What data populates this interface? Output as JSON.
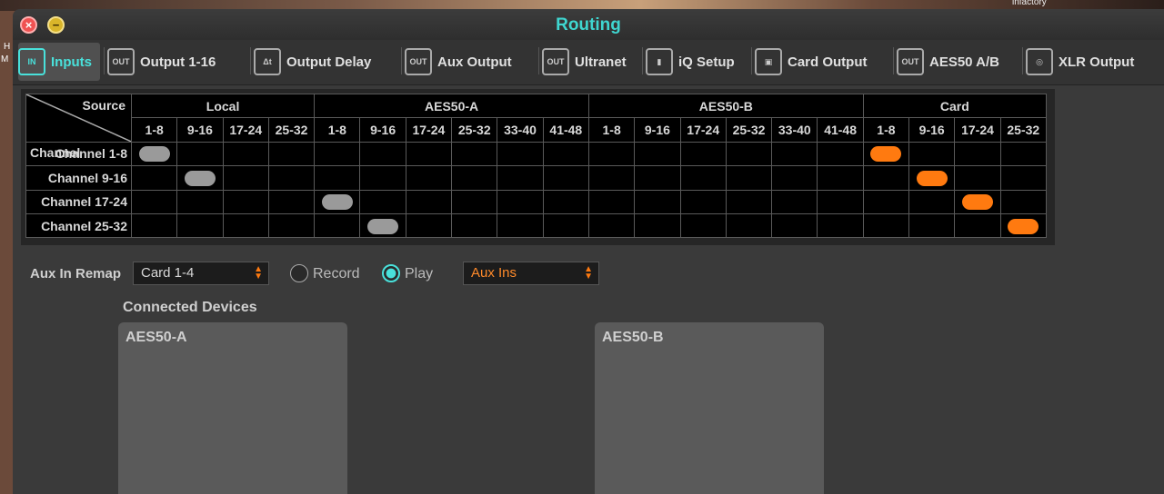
{
  "desktop": {
    "corner_text": "infactory",
    "side_h": "H",
    "side_m": "M"
  },
  "window": {
    "title": "Routing"
  },
  "tabs": [
    {
      "label": "Inputs",
      "icon": "input-icon",
      "glyph": "IN"
    },
    {
      "label": "Output 1-16",
      "icon": "output-icon",
      "glyph": "OUT"
    },
    {
      "label": "Output Delay",
      "icon": "delay-icon",
      "glyph": "Δt"
    },
    {
      "label": "Aux Output",
      "icon": "aux-output-icon",
      "glyph": "OUT"
    },
    {
      "label": "Ultranet",
      "icon": "ultranet-icon",
      "glyph": "OUT"
    },
    {
      "label": "iQ Setup",
      "icon": "speaker-icon",
      "glyph": "▮"
    },
    {
      "label": "Card Output",
      "icon": "card-icon",
      "glyph": "▣"
    },
    {
      "label": "AES50 A/B",
      "icon": "aes50-icon",
      "glyph": "OUT"
    },
    {
      "label": "XLR Output",
      "icon": "xlr-icon",
      "glyph": "◎"
    }
  ],
  "grid": {
    "corner_source": "Source",
    "corner_channel": "Channel",
    "groups": [
      {
        "label": "Local",
        "cols": [
          "1-8",
          "9-16",
          "17-24",
          "25-32"
        ]
      },
      {
        "label": "AES50-A",
        "cols": [
          "1-8",
          "9-16",
          "17-24",
          "25-32",
          "33-40",
          "41-48"
        ]
      },
      {
        "label": "AES50-B",
        "cols": [
          "1-8",
          "9-16",
          "17-24",
          "25-32",
          "33-40",
          "41-48"
        ]
      },
      {
        "label": "Card",
        "cols": [
          "1-8",
          "9-16",
          "17-24",
          "25-32"
        ]
      }
    ],
    "rows": [
      {
        "label": "Channel 1-8"
      },
      {
        "label": "Channel 9-16"
      },
      {
        "label": "Channel 17-24"
      },
      {
        "label": "Channel 25-32"
      }
    ],
    "routes": [
      {
        "row": 0,
        "col": 0,
        "color": "#9a9a9a"
      },
      {
        "row": 1,
        "col": 1,
        "color": "#9a9a9a"
      },
      {
        "row": 2,
        "col": 4,
        "color": "#9a9a9a"
      },
      {
        "row": 3,
        "col": 5,
        "color": "#9a9a9a"
      },
      {
        "row": 0,
        "col": 16,
        "color": "#ff7a10"
      },
      {
        "row": 1,
        "col": 17,
        "color": "#ff7a10"
      },
      {
        "row": 2,
        "col": 18,
        "color": "#ff7a10"
      },
      {
        "row": 3,
        "col": 19,
        "color": "#ff7a10"
      }
    ]
  },
  "aux": {
    "label": "Aux In Remap",
    "remap_value": "Card 1-4",
    "record_label": "Record",
    "play_label": "Play",
    "mode": "Play",
    "ins_value": "Aux Ins"
  },
  "devices": {
    "label": "Connected Devices",
    "a": "AES50-A",
    "b": "AES50-B"
  }
}
